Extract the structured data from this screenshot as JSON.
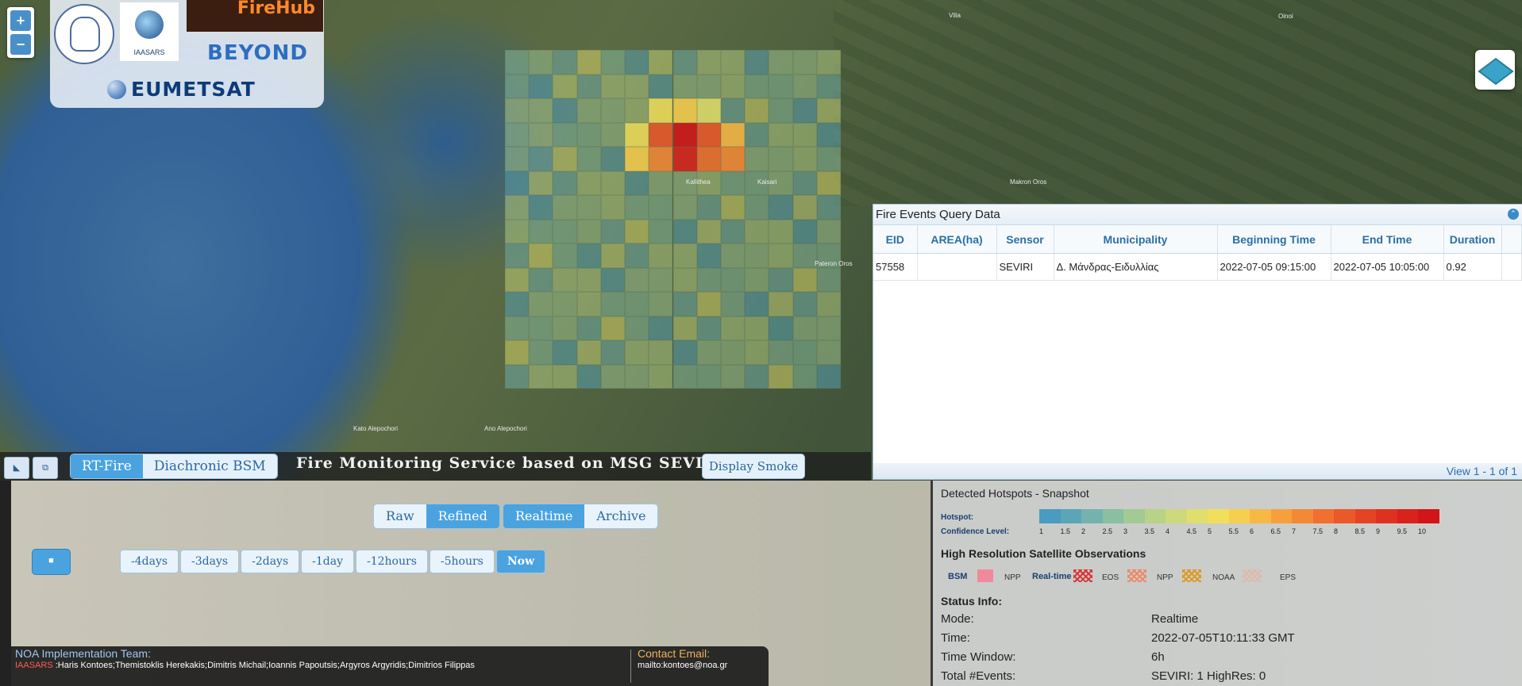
{
  "map": {
    "zoom_in": "+",
    "zoom_out": "−",
    "places": [
      "Vilia",
      "Oinoi",
      "Kallithea",
      "Kaisari",
      "Makron Oros",
      "Ano Alepochori",
      "Kato Alepochori",
      "Pateron Oros"
    ]
  },
  "logos": {
    "iaasars": "IAASARS",
    "firehub": "FireHub",
    "beyond": "BEYOND",
    "eumetsat": "EUMETSAT"
  },
  "fire_events": {
    "title": "Fire Events Query Data",
    "columns": [
      "EID",
      "AREA(ha)",
      "Sensor",
      "Municipality",
      "Beginning Time",
      "End Time",
      "Duration"
    ],
    "rows": [
      [
        "57558",
        "",
        "SEVIRI",
        "Δ. Μάνδρας-Ειδυλλίας",
        "2022-07-05 09:15:00",
        "2022-07-05 10:05:00",
        "0.92"
      ]
    ],
    "footer": "View 1 - 1 of 1"
  },
  "toolbar": {
    "rt_fire": "RT-Fire",
    "diachronic": "Diachronic BSM",
    "banner": "Fire Monitoring Service based on MSG SEVIRI",
    "display_smoke": "Display Smoke"
  },
  "controls": {
    "raw": "Raw",
    "refined": "Refined",
    "realtime": "Realtime",
    "archive": "Archive",
    "stop": "■",
    "time_windows": [
      "-4days",
      "-3days",
      "-2days",
      "-1day",
      "-12hours",
      "-5hours",
      "Now"
    ]
  },
  "team": {
    "heading": "NOA Implementation Team:",
    "org": "IAASARS",
    "members": " :Haris Kontoes;Themistoklis Herekakis;Dimitris Michail;Ioannis Papoutsis;Argyros Argyridis;Dimitrios Filippas",
    "contact_heading": "Contact Email:",
    "contact": "mailto:kontoes@noa.gr"
  },
  "legend": {
    "title": "Detected Hotspots - Snapshot",
    "hotspot_label": "Hotspot:",
    "confidence_label": "Confidence Level:",
    "confidence_levels": [
      "1",
      "1.5",
      "2",
      "2.5",
      "3",
      "3.5",
      "4",
      "4.5",
      "5",
      "5.5",
      "6",
      "6.5",
      "7",
      "7.5",
      "8",
      "8.5",
      "9",
      "9.5",
      "10"
    ],
    "scale_colors": [
      "#4a9bbf",
      "#5aa6b8",
      "#74b3ad",
      "#8bbfa1",
      "#a3c994",
      "#b8d288",
      "#cdd97b",
      "#e0de6c",
      "#f0df5c",
      "#f7cf4e",
      "#f8b845",
      "#f6a03d",
      "#f38936",
      "#ef7030",
      "#ea592a",
      "#e44424",
      "#de3220",
      "#d8221c",
      "#d11518"
    ],
    "highres_title": "High Resolution Satellite Observations",
    "bsm": "BSM",
    "npp1": "NPP",
    "realtime": "Real-time",
    "eos": "EOS",
    "npp2": "NPP",
    "noaa": "NOAA",
    "eps": "EPS"
  },
  "status": {
    "heading": "Status Info:",
    "mode_label": "Mode:",
    "mode": "Realtime",
    "time_label": "Time:",
    "time": "2022-07-05T10:11:33 GMT",
    "window_label": "Time Window:",
    "window": "6h",
    "total_label": "Total #Events:",
    "total": "SEVIRI: 1  HighRes: 0"
  }
}
